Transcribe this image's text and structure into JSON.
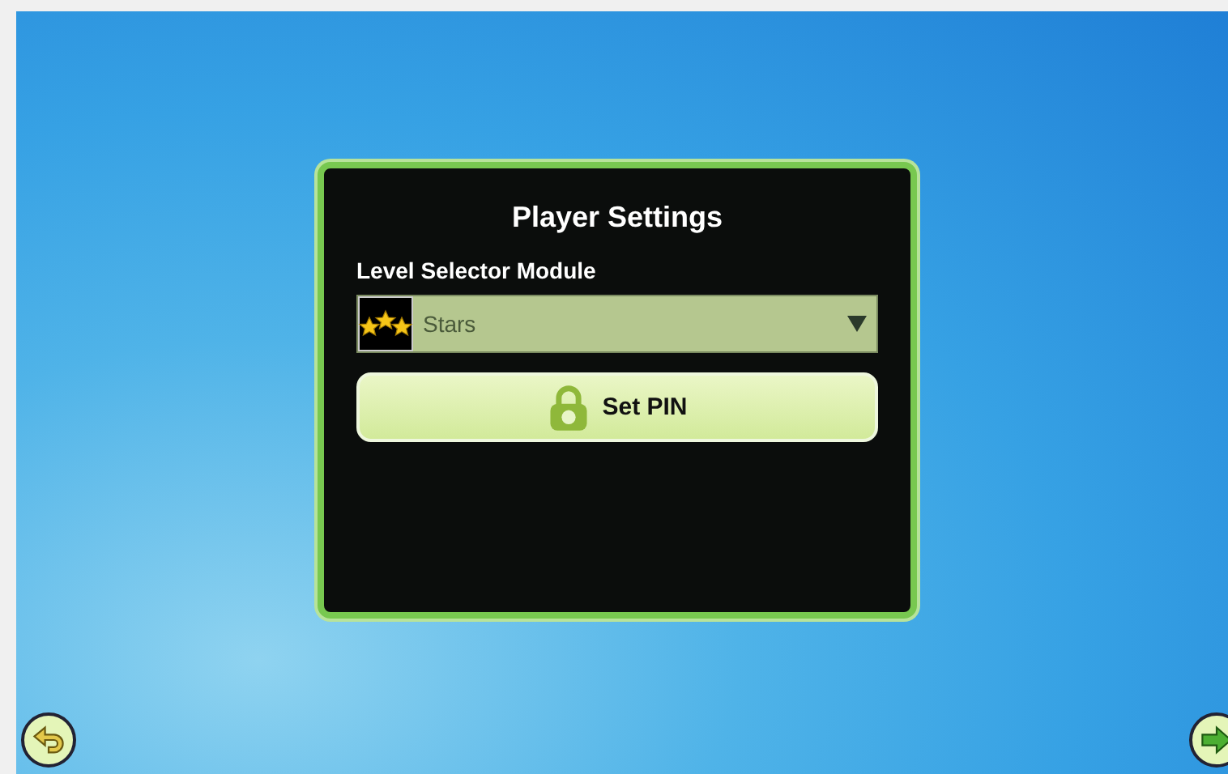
{
  "dialog": {
    "title": "Player Settings",
    "field": {
      "label": "Level Selector Module",
      "value": "Stars"
    },
    "button": {
      "label": "Set PIN"
    }
  }
}
